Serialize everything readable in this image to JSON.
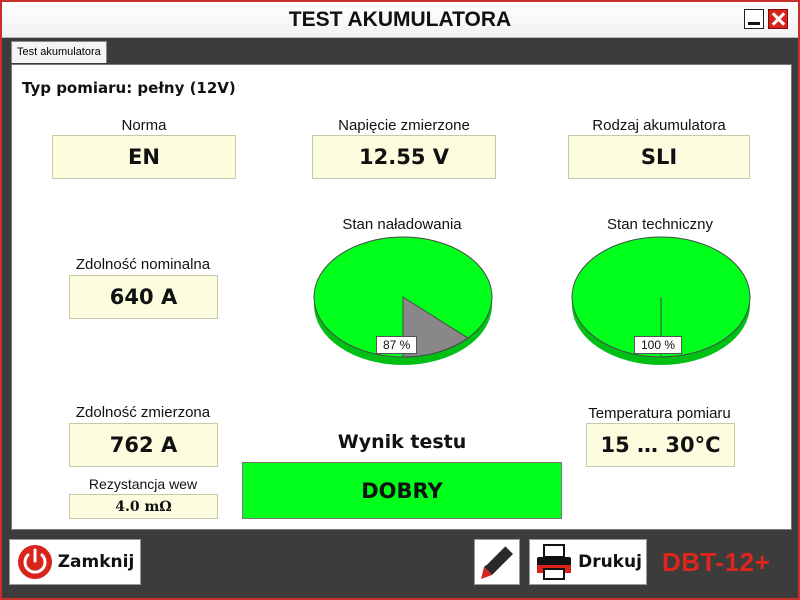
{
  "window": {
    "title": "TEST AKUMULATORA"
  },
  "tab": {
    "label": "Test akumulatora"
  },
  "measure_type": "Typ pomiaru: pełny (12V)",
  "fields": {
    "norm": {
      "label": "Norma",
      "value": "EN"
    },
    "measured_voltage": {
      "label": "Napięcie zmierzone",
      "value": "12.55 V"
    },
    "battery_type": {
      "label": "Rodzaj akumulatora",
      "value": "SLI"
    },
    "nominal_capacity": {
      "label": "Zdolność nominalna",
      "value": "640 A"
    },
    "measured_capacity": {
      "label": "Zdolność zmierzona",
      "value": "762 A"
    },
    "internal_resistance": {
      "label": "Rezystancja wew",
      "value": "4.0 mΩ"
    },
    "temperature": {
      "label": "Temperatura pomiaru",
      "value": "15 … 30°C"
    }
  },
  "charge_state": {
    "label": "Stan naładowania",
    "percent_text": "87 %",
    "percent": 87,
    "color_fill": "#00ff1a",
    "color_rest": "#888888"
  },
  "technical_state": {
    "label": "Stan techniczny",
    "percent_text": "100 %",
    "percent": 100,
    "color_fill": "#00ff1a"
  },
  "result": {
    "title": "Wynik testu",
    "value": "DOBRY",
    "color": "#00ff1a"
  },
  "buttons": {
    "close_label": "Zamknij",
    "print_label": "Drukuj"
  },
  "brand": "DBT-12+",
  "icons": {
    "close": "power-icon",
    "edit": "pencil-icon",
    "print": "printer-icon"
  }
}
